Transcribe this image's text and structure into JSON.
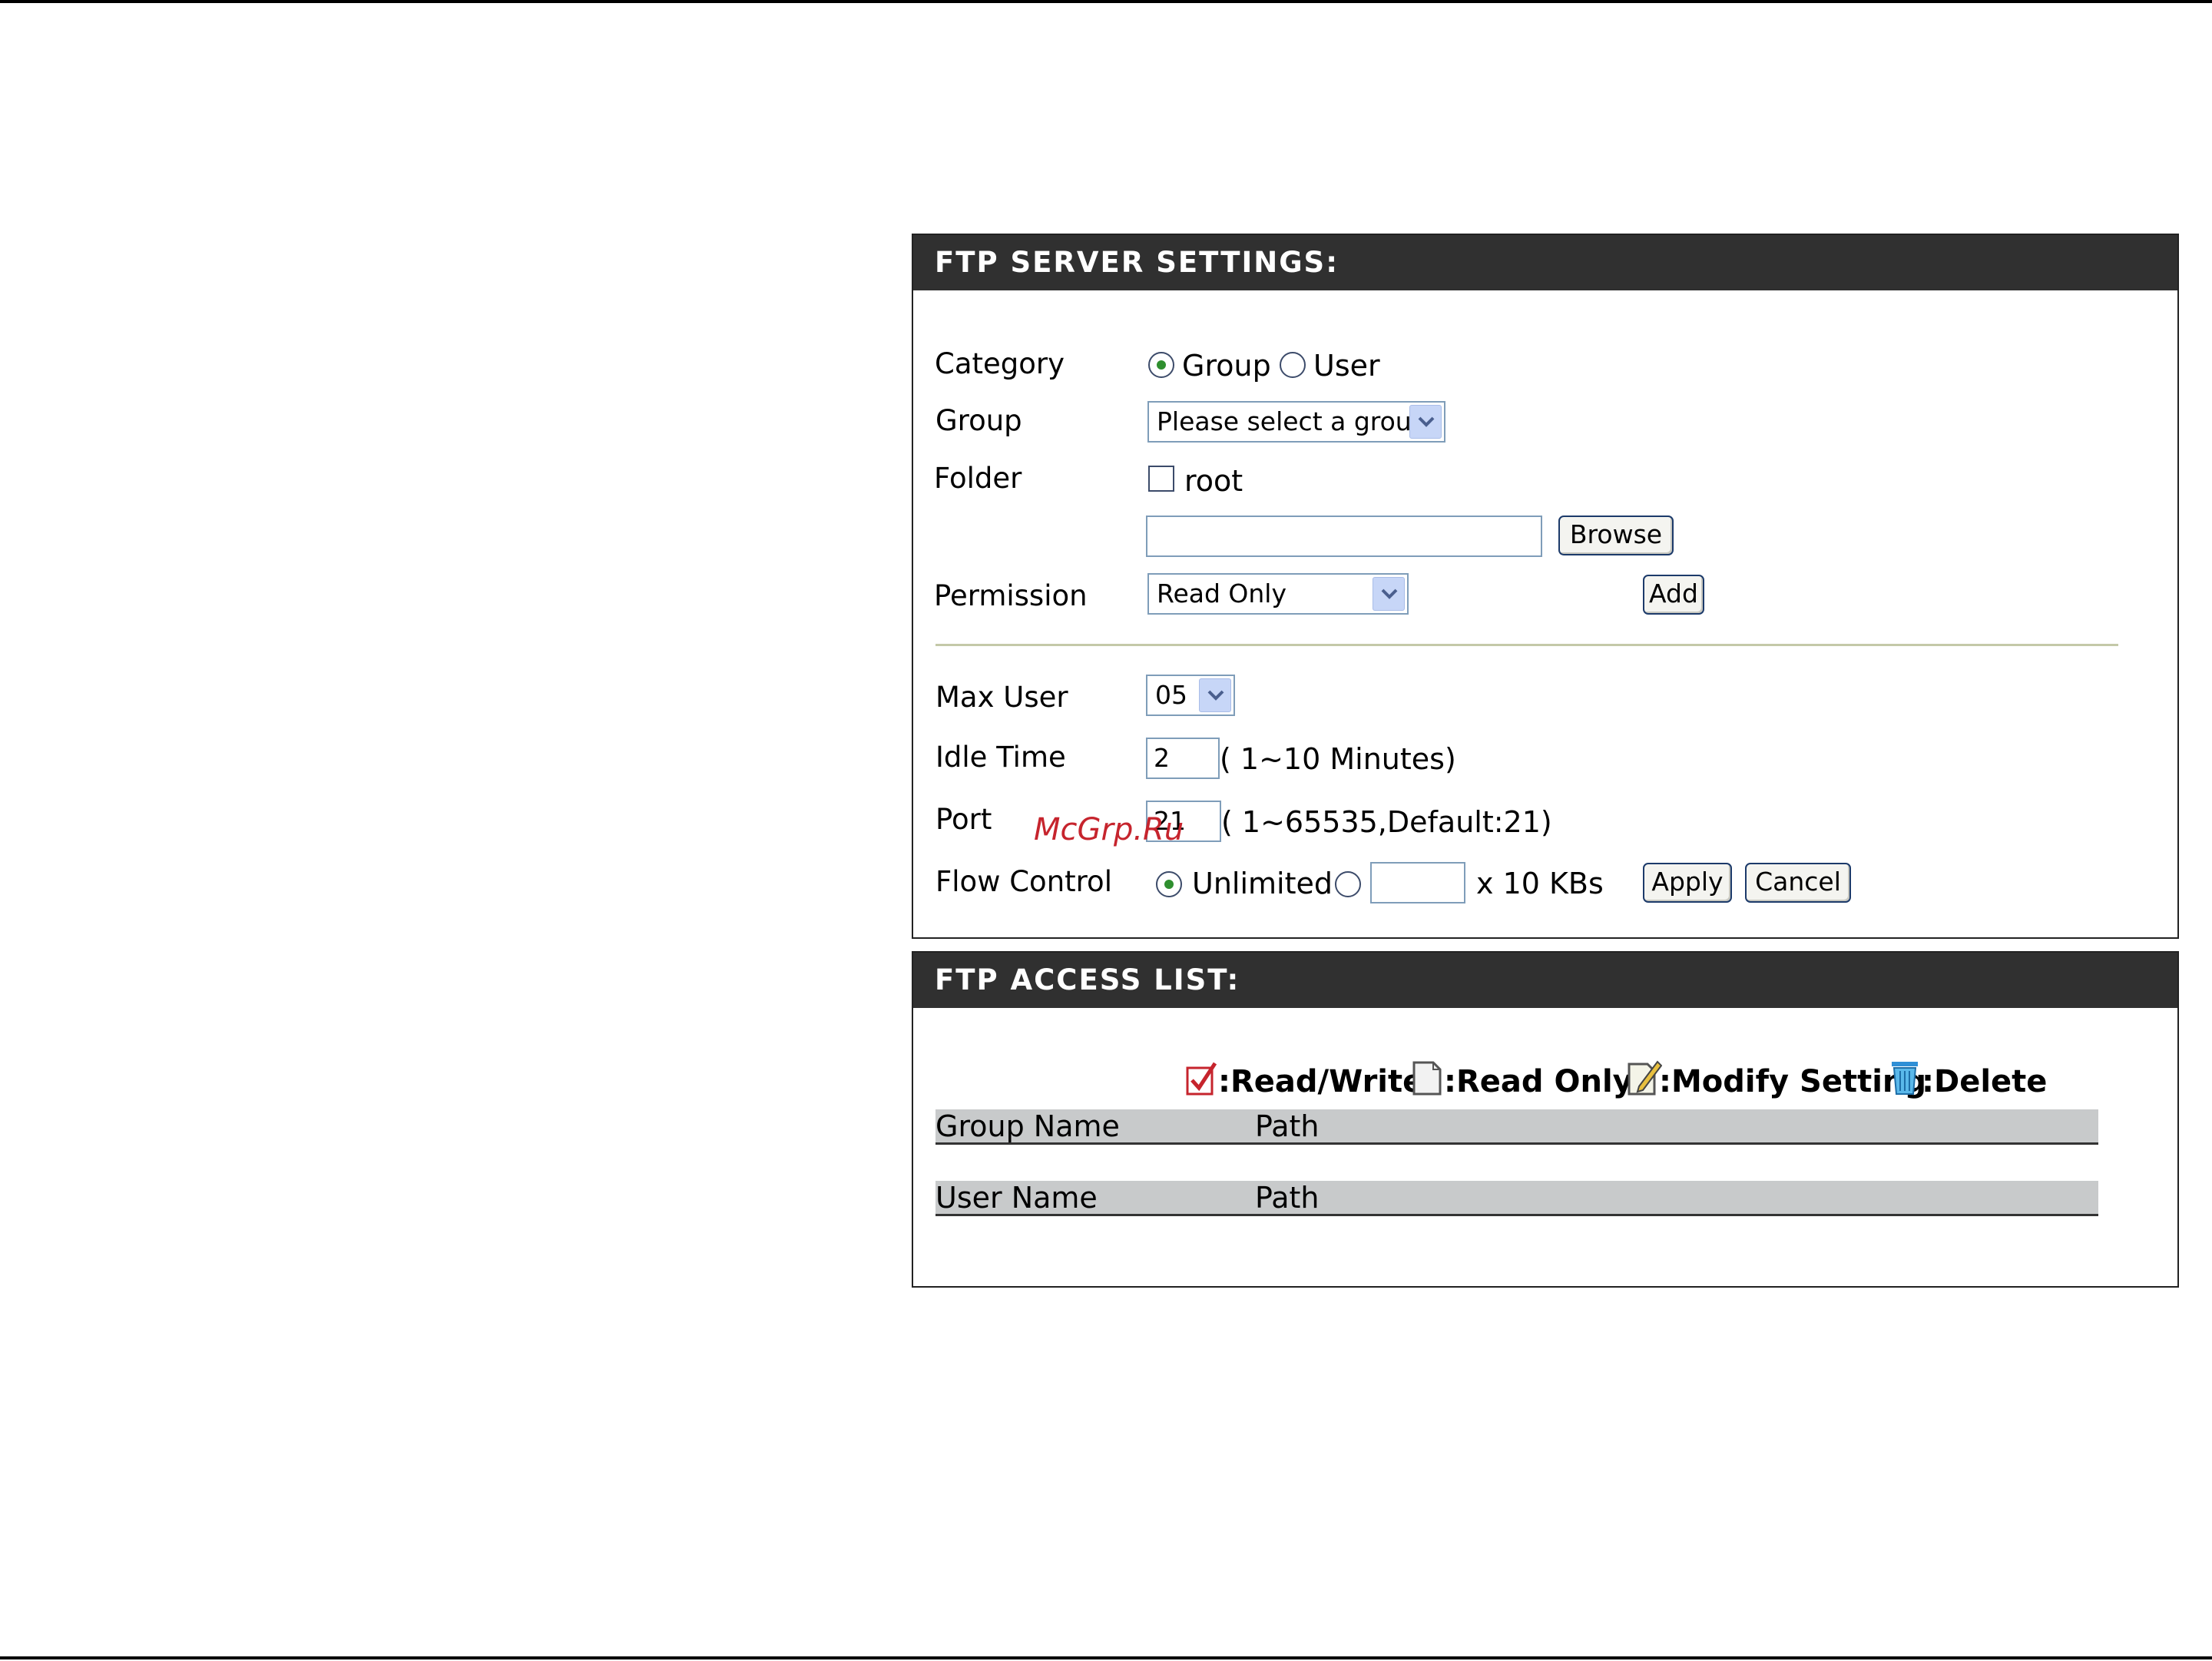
{
  "settings": {
    "title": "FTP SERVER SETTINGS:",
    "category": {
      "label": "Category",
      "option_group": "Group",
      "option_user": "User",
      "selected": "Group"
    },
    "group": {
      "label": "Group",
      "value": "Please select a group"
    },
    "folder": {
      "label": "Folder",
      "root_label": "root",
      "root_checked": false,
      "path_value": "",
      "browse_label": "Browse"
    },
    "permission": {
      "label": "Permission",
      "value": "Read Only",
      "add_label": "Add"
    },
    "max_user": {
      "label": "Max User",
      "value": "05"
    },
    "idle_time": {
      "label": "Idle Time",
      "value": "2",
      "hint": "( 1~10 Minutes)"
    },
    "port": {
      "label": "Port",
      "value": "21",
      "hint": "( 1~65535,Default:21)"
    },
    "flow_control": {
      "label": "Flow Control",
      "unlimited_label": "Unlimited",
      "selected": "Unlimited",
      "rate_value": "",
      "unit": "x 10 KBs",
      "apply_label": "Apply",
      "cancel_label": "Cancel"
    }
  },
  "access_list": {
    "title": "FTP ACCESS LIST:",
    "legend": {
      "read_write": ":Read/Write",
      "read_only": ":Read Only",
      "modify": ":Modify Setting",
      "delete": ":Delete"
    },
    "group_table": {
      "col1": "Group Name",
      "col2": "Path"
    },
    "user_table": {
      "col1": "User Name",
      "col2": "Path"
    }
  },
  "watermark": "McGrp.Ru",
  "colors": {
    "header_bg": "#303030",
    "table_header_bg": "#c8cacb",
    "watermark": "#c6242d"
  }
}
